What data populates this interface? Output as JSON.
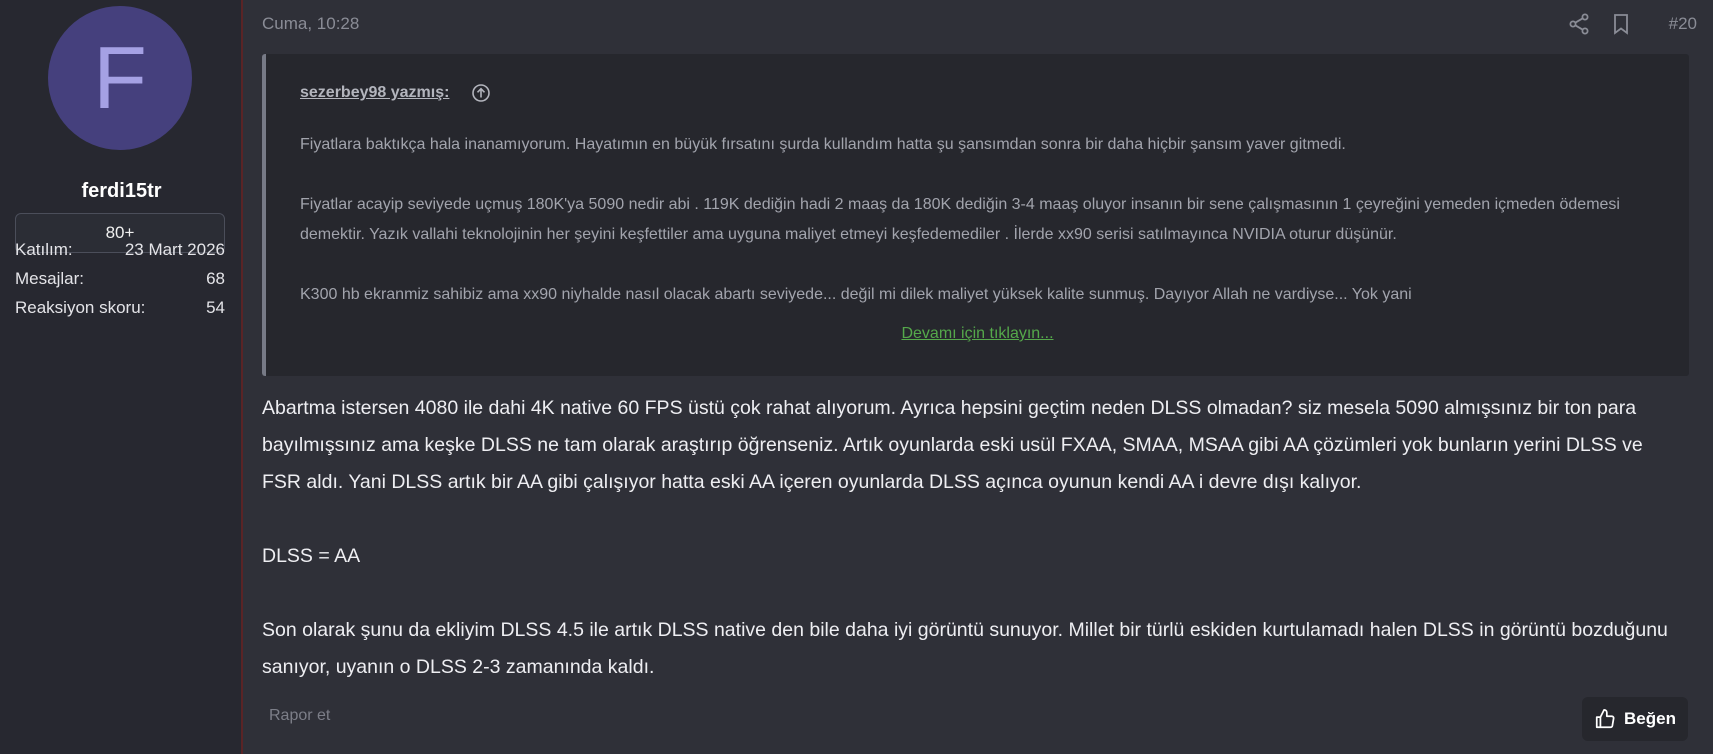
{
  "user": {
    "avatar_letter": "F",
    "avatar_color": "#45407d",
    "username": "ferdi15tr",
    "rank": "80+",
    "stats": [
      {
        "label": "Katılım:",
        "value": "23 Mart 2026"
      },
      {
        "label": "Mesajlar:",
        "value": "68"
      },
      {
        "label": "Reaksiyon skoru:",
        "value": "54"
      }
    ]
  },
  "post": {
    "time": "Cuma, 10:28",
    "number": "#20",
    "share_icon": "share-icon",
    "bookmark_icon": "bookmark-icon"
  },
  "quote": {
    "author_line": "sezerbey98 yazmış:",
    "paragraphs": [
      "Fiyatlara baktıkça hala inanamıyorum. Hayatımın en büyük fırsatını şurda kullandım hatta şu şansımdan sonra bir daha hiçbir şansım yaver gitmedi.",
      "Fiyatlar acayip seviyede uçmuş 180K'ya 5090 nedir abi . 119K dediğin hadi 2 maaş da 180K dediğin 3-4 maaş oluyor insanın bir sene çalışmasının 1 çeyreğini yemeden içmeden ödemesi demektir. Yazık vallahi teknolojinin her şeyini keşfettiler ama uyguna maliyet etmeyi keşfedemediler . İlerde xx90 serisi satılmayınca NVIDIA oturur düşünür.",
      "K300 hb ekranmiz sahibiz ama xx90 niyhalde nasıl olacak abartı seviyede... değil mi dilek maliyet yüksek kalite sunmuş. Dayıyor Allah ne vardiyse... Yok yani"
    ],
    "expand_link": "Devamı için tıklayın..."
  },
  "message": {
    "paragraphs": [
      "Abartma istersen 4080 ile dahi 4K native 60 FPS üstü çok rahat alıyorum. Ayrıca hepsini geçtim neden DLSS olmadan? siz mesela 5090 almışsınız bir ton para bayılmışsınız ama keşke DLSS ne tam olarak araştırıp öğrenseniz. Artık oyunlarda eski usül FXAA, SMAA, MSAA gibi AA çözümleri yok bunların yerini DLSS ve FSR aldı. Yani DLSS artık bir AA gibi çalışıyor hatta eski AA içeren oyunlarda DLSS açınca oyunun kendi AA i devre dışı kalıyor.",
      "DLSS = AA",
      "Son olarak şunu da ekliyim DLSS 4.5 ile artık DLSS native den bile daha iyi görüntü sunuyor. Millet bir türlü eskiden kurtulamadı halen DLSS in görüntü bozduğunu sanıyor, uyanın o DLSS 2-3 zamanında kaldı."
    ]
  },
  "footer": {
    "report_label": "Rapor et",
    "like_label": "Beğen",
    "like_icon": "thumbs-up-icon"
  }
}
